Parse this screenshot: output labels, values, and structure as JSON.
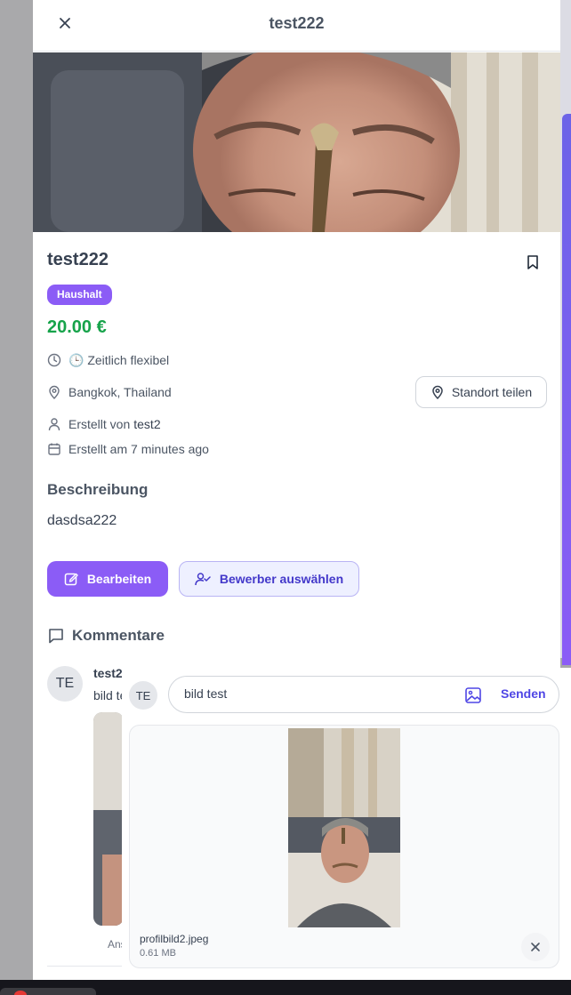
{
  "header": {
    "title": "test222",
    "close_icon": "close-icon"
  },
  "job": {
    "title": "test222",
    "category": "Haushalt",
    "price": "20.00 €",
    "time": "🕒 Zeitlich flexibel",
    "location": "Bangkok, Thailand",
    "created_by_label": "Erstellt von",
    "created_by_user": "test2",
    "created_at": "Erstellt am 7 minutes ago",
    "share_location_label": "Standort teilen"
  },
  "description": {
    "heading": "Beschreibung",
    "text": "dasdsa222"
  },
  "actions": {
    "edit_label": "Bearbeiten",
    "select_applicant_label": "Bewerber auswählen"
  },
  "comments": {
    "heading": "Kommentare",
    "items": [
      {
        "avatar": "TE",
        "author": "test2",
        "text": "bild test",
        "action": "Ansehen"
      }
    ]
  },
  "composer": {
    "avatar": "TE",
    "input_value": "bild test",
    "send_label": "Senden",
    "attachment": {
      "name": "profilbild2.jpeg",
      "size": "0.61 MB"
    }
  },
  "colors": {
    "accent": "#8b5cf6",
    "price": "#16a34a",
    "link": "#4f46e5"
  }
}
